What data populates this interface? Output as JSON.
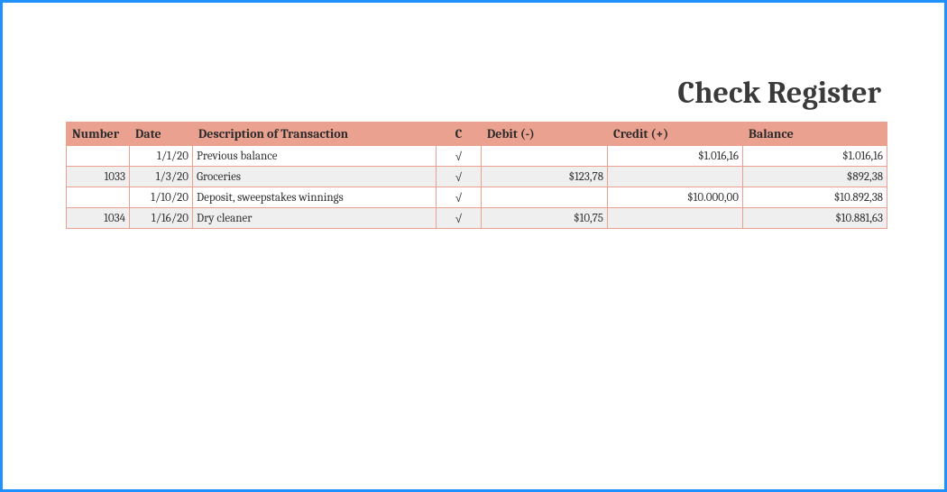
{
  "title": "Check Register",
  "headers": {
    "number": "Number",
    "date": "Date",
    "description": "Description of Transaction",
    "c": "C",
    "debit": "Debit   (-)",
    "credit": "Credit (+)",
    "balance": "Balance"
  },
  "rows": [
    {
      "number": "",
      "date": "1/1/20",
      "description": "Previous balance",
      "c": "√",
      "debit": "",
      "credit": "$1.016,16",
      "balance": "$1.016,16"
    },
    {
      "number": "1033",
      "date": "1/3/20",
      "description": "Groceries",
      "c": "√",
      "debit": "$123,78",
      "credit": "",
      "balance": "$892,38"
    },
    {
      "number": "",
      "date": "1/10/20",
      "description": "Deposit, sweepstakes winnings",
      "c": "√",
      "debit": "",
      "credit": "$10.000,00",
      "balance": "$10.892,38"
    },
    {
      "number": "1034",
      "date": "1/16/20",
      "description": "Dry cleaner",
      "c": "√",
      "debit": "$10,75",
      "credit": "",
      "balance": "$10.881,63"
    }
  ]
}
